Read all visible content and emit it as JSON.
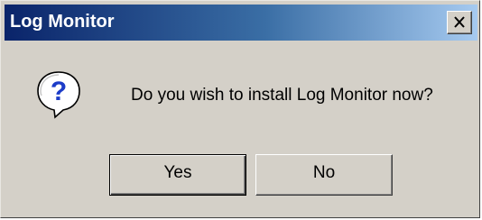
{
  "window": {
    "title": "Log Monitor"
  },
  "dialog": {
    "message": "Do you wish to install Log Monitor now?",
    "icon": "question-icon"
  },
  "buttons": {
    "yes_label": "Yes",
    "no_label": "No"
  },
  "colors": {
    "titlebar_start": "#0a246a",
    "titlebar_end": "#a6caf0",
    "dialog_bg": "#d4d0c8",
    "icon_blue": "#1c3cc8"
  }
}
